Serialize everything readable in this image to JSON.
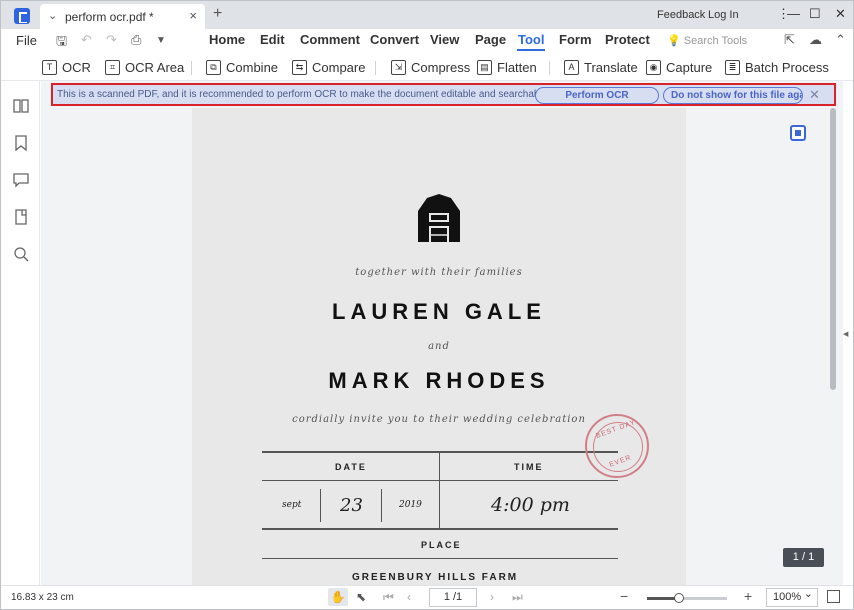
{
  "tab": {
    "title": "perform ocr.pdf *"
  },
  "titlebar": {
    "feedback": "Feedback",
    "login": "Log In"
  },
  "menu": {
    "file": "File",
    "items": [
      "Home",
      "Edit",
      "Comment",
      "Convert",
      "View",
      "Page",
      "Tool",
      "Form",
      "Protect"
    ],
    "active": "Tool",
    "search_placeholder": "Search Tools"
  },
  "toolbar": {
    "tools": [
      "OCR",
      "OCR Area",
      "Combine",
      "Compare",
      "Compress",
      "Flatten",
      "Translate",
      "Capture",
      "Batch Process"
    ]
  },
  "banner": {
    "message": "This is a scanned PDF, and it is recommended to perform OCR to make the document editable and searchable.",
    "perform_label": "Perform OCR",
    "dismiss_label": "Do not show for this file again"
  },
  "document": {
    "intro": "together with their families",
    "name1": "LAUREN GALE",
    "and": "and",
    "name2": "MARK RHODES",
    "invite": "cordially invite you to their wedding celebration",
    "date_label": "DATE",
    "time_label": "TIME",
    "month": "sept",
    "day": "23",
    "year": "2019",
    "time": "4:00 pm",
    "place_label": "PLACE",
    "venue": "GREENBURY HILLS FARM",
    "stamp_top": "BEST DAY",
    "stamp_bottom": "EVER"
  },
  "page_counter": "1 / 1",
  "status": {
    "dimensions": "16.83 x 23 cm",
    "page_input": "1 /1",
    "zoom": "100%",
    "zoom_level": 0.4
  },
  "icons": {
    "sidebar": [
      "thumbnails-icon",
      "bookmark-icon",
      "comment-icon",
      "attachment-icon",
      "search-icon"
    ]
  },
  "colors": {
    "accent": "#2d6cdf",
    "banner_bg": "#d7def2",
    "banner_border": "#d8232a",
    "stamp": "#c96a73"
  }
}
